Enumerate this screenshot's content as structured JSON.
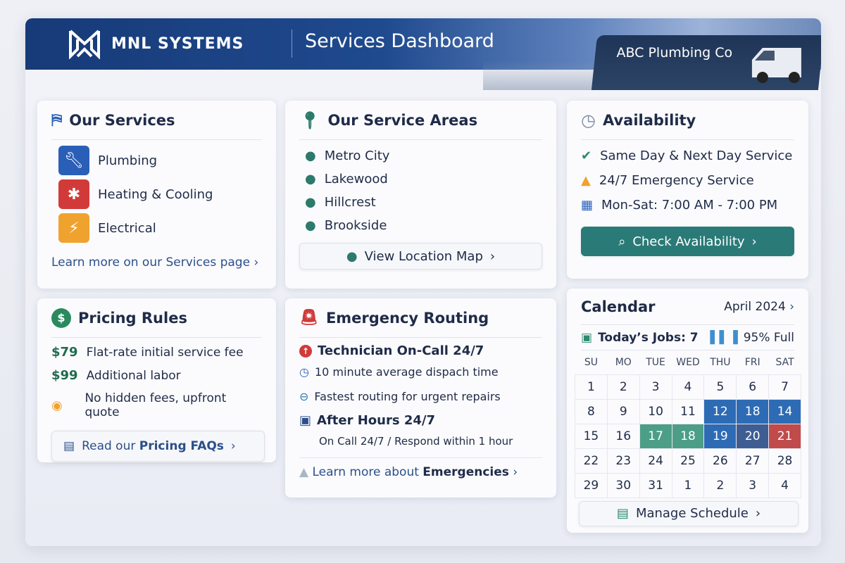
{
  "header": {
    "brand": "MNL SYSTEMS",
    "title": "Services Dashboard",
    "company": "ABC Plumbing Co"
  },
  "services": {
    "title": "Our Services",
    "items": [
      {
        "label": "Plumbing",
        "icon": "wrench-icon",
        "color": "#2a5fb8"
      },
      {
        "label": "Heating & Cooling",
        "icon": "snowflake-icon",
        "color": "#d23a3a"
      },
      {
        "label": "Electrical",
        "icon": "lightning-icon",
        "color": "#f0a22e"
      }
    ],
    "link": "Learn more on our Services page"
  },
  "areas": {
    "title": "Our Service Areas",
    "items": [
      "Metro City",
      "Lakewood",
      "Hillcrest",
      "Brookside"
    ],
    "button": "View Location Map"
  },
  "availability": {
    "title": "Availability",
    "items": [
      "Same Day & Next Day Service",
      "24/7 Emergency Service",
      "Mon-Sat: 7:00 AM - 7:00 PM"
    ],
    "button": "Check Availability"
  },
  "pricing": {
    "title": "Pricing Rules",
    "items": [
      {
        "price": "$79",
        "desc": "Flat-rate initial service fee"
      },
      {
        "price": "$99",
        "desc": "Additional labor"
      },
      {
        "price": "",
        "desc": "No hidden fees, upfront quote"
      }
    ],
    "button_prefix": "Read our ",
    "button_bold": "Pricing FAQs"
  },
  "emergency": {
    "title": "Emergency Routing",
    "oncall": "Technician On-Call 24/7",
    "dispatch": "10 minute average dispach time",
    "fastest": "Fastest routing for urgent repairs",
    "after": "After Hours 24/7",
    "after_sub": "On Call 24/7 / Respond within 1 hour",
    "link_prefix": "Learn more about ",
    "link_bold": "Emergencies"
  },
  "calendar": {
    "title": "Calendar",
    "month": "April 2024",
    "jobs": "Today’s Jobs: 7",
    "full": "95% Full",
    "days": [
      "SU",
      "MO",
      "TUE",
      "WED",
      "THU",
      "FRI",
      "SAT"
    ],
    "weeks": [
      [
        "1",
        "2",
        "3",
        "4",
        "5",
        "6",
        "7"
      ],
      [
        "8",
        "9",
        "10",
        "11",
        "12",
        "18",
        "14"
      ],
      [
        "15",
        "16",
        "17",
        "18",
        "19",
        "20",
        "21"
      ],
      [
        "22",
        "23",
        "24",
        "25",
        "26",
        "27",
        "28"
      ],
      [
        "29",
        "30",
        "31",
        "1",
        "2",
        "3",
        "4"
      ]
    ],
    "highlights": {
      "1-4": "b",
      "1-5": "b",
      "1-6": "b",
      "2-2": "g",
      "2-3": "g",
      "2-4": "b",
      "2-5": "d",
      "2-6": "r"
    },
    "button": "Manage Schedule"
  }
}
